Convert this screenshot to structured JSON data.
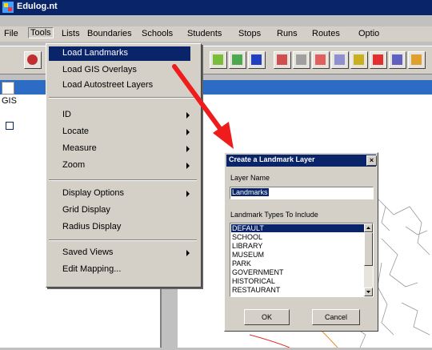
{
  "window": {
    "title": "Edulog.nt"
  },
  "menubar": {
    "items": [
      {
        "label": "File",
        "key": "file"
      },
      {
        "label": "Tools",
        "key": "tools"
      },
      {
        "label": "Lists",
        "key": "lists"
      },
      {
        "label": "Boundaries",
        "key": "boundaries"
      },
      {
        "label": "Schools",
        "key": "schools"
      },
      {
        "label": "Students",
        "key": "students"
      },
      {
        "label": "Stops",
        "key": "stops"
      },
      {
        "label": "Runs",
        "key": "runs"
      },
      {
        "label": "Routes",
        "key": "routes"
      },
      {
        "label": "Optio",
        "key": "options"
      }
    ]
  },
  "left_panel": {
    "label": "GIS"
  },
  "tools_menu": {
    "items": [
      {
        "label": "Load Landmarks",
        "highlighted": true
      },
      {
        "label": "Load GIS Overlays"
      },
      {
        "label": "Load Autostreet Layers"
      },
      {
        "label": "ID",
        "submenu": true
      },
      {
        "label": "Locate",
        "submenu": true
      },
      {
        "label": "Measure",
        "submenu": true
      },
      {
        "label": "Zoom",
        "submenu": true
      },
      {
        "label": "Display Options",
        "submenu": true
      },
      {
        "label": "Grid Display"
      },
      {
        "label": "Radius Display"
      },
      {
        "label": "Saved Views",
        "submenu": true
      },
      {
        "label": "Edit Mapping..."
      }
    ]
  },
  "dialog": {
    "title": "Create a Landmark Layer",
    "close": "×",
    "layer_name_label": "Layer Name",
    "layer_name_value": "Landmarks",
    "types_label": "Landmark Types To Include",
    "types": [
      "DEFAULT",
      "SCHOOL",
      "LIBRARY",
      "MUSEUM",
      "PARK",
      "GOVERNMENT",
      "HISTORICAL",
      "RESTAURANT"
    ],
    "selected_type": "DEFAULT",
    "ok": "OK",
    "cancel": "Cancel"
  },
  "colors": {
    "titlebar": "#0a246a",
    "arrow": "#ee1c1c",
    "child_titlebar": "#2c6cc4"
  }
}
